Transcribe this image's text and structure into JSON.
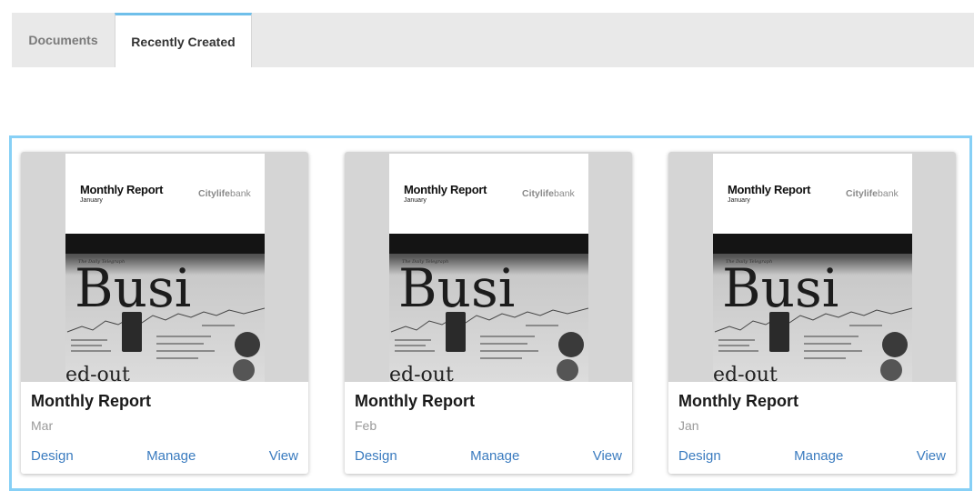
{
  "tabs": [
    {
      "label": "Documents",
      "active": false
    },
    {
      "label": "Recently Created",
      "active": true
    }
  ],
  "colors": {
    "accent": "#6fbfea",
    "frame": "#87d0f6",
    "link": "#3a7bbf"
  },
  "cover": {
    "title": "Monthly Report",
    "subtitle": "January",
    "brand_bold": "Citylife",
    "brand_light": "bank",
    "photo_headline": "Busi",
    "photo_masthead": "The Daily Telegraph",
    "photo_footer": "ed-out"
  },
  "cards": [
    {
      "title": "Monthly Report",
      "date": "Mar",
      "actions": {
        "design": "Design",
        "manage": "Manage",
        "view": "View"
      }
    },
    {
      "title": "Monthly Report",
      "date": "Feb",
      "actions": {
        "design": "Design",
        "manage": "Manage",
        "view": "View"
      }
    },
    {
      "title": "Monthly Report",
      "date": "Jan",
      "actions": {
        "design": "Design",
        "manage": "Manage",
        "view": "View"
      }
    }
  ]
}
